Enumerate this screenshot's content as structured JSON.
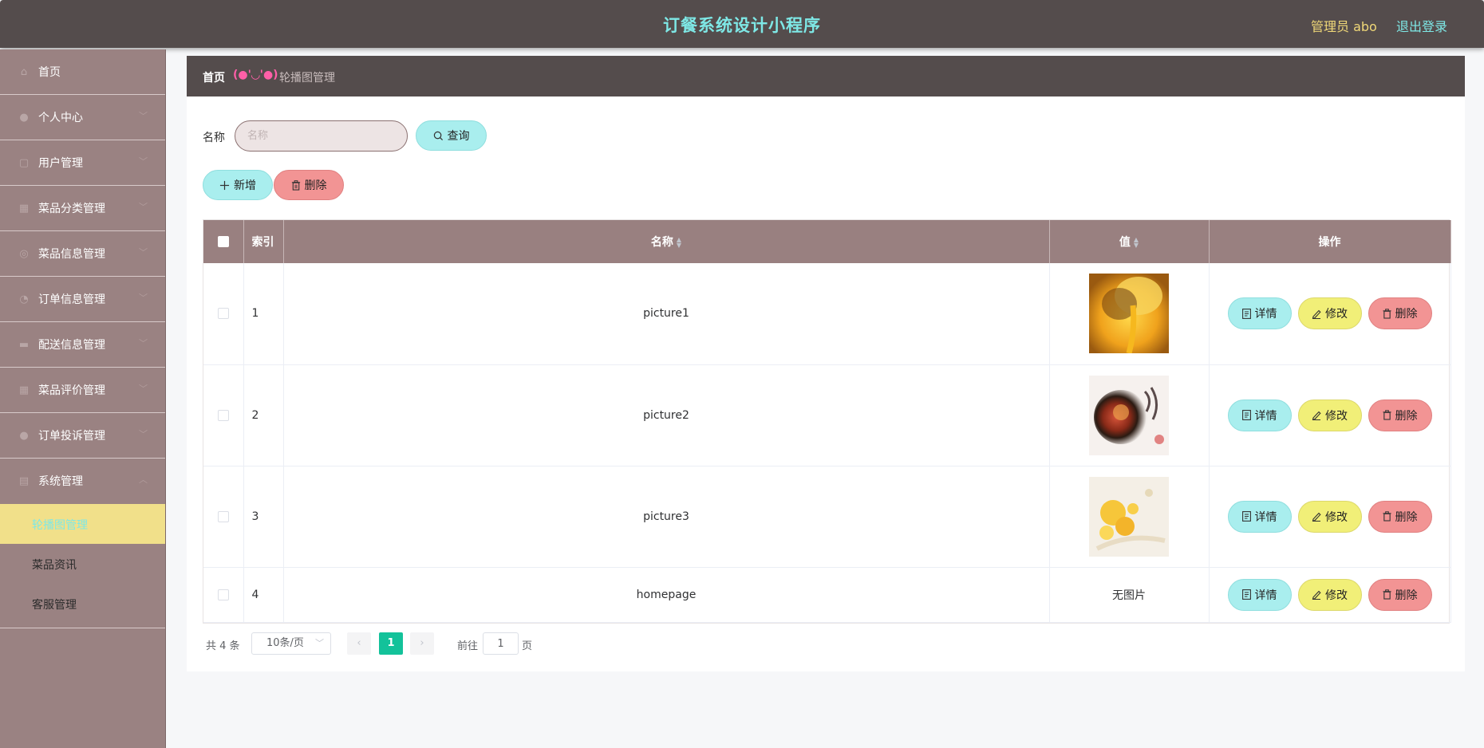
{
  "header": {
    "title": "订餐系统设计小程序",
    "admin": "管理员 abo",
    "logout": "退出登录"
  },
  "sidebar": {
    "items": [
      {
        "label": "首页",
        "icon": "home-icon",
        "arrow": false
      },
      {
        "label": "个人中心",
        "icon": "user-icon",
        "arrow": true
      },
      {
        "label": "用户管理",
        "icon": "users-icon",
        "arrow": true
      },
      {
        "label": "菜品分类管理",
        "icon": "category-icon",
        "arrow": true
      },
      {
        "label": "菜品信息管理",
        "icon": "dish-icon",
        "arrow": true
      },
      {
        "label": "订单信息管理",
        "icon": "order-icon",
        "arrow": true
      },
      {
        "label": "配送信息管理",
        "icon": "delivery-icon",
        "arrow": true
      },
      {
        "label": "菜品评价管理",
        "icon": "review-icon",
        "arrow": true
      },
      {
        "label": "订单投诉管理",
        "icon": "complaint-icon",
        "arrow": true
      },
      {
        "label": "系统管理",
        "icon": "settings-icon",
        "arrow": true
      }
    ],
    "subitems": [
      "轮播图管理",
      "菜品资讯",
      "客服管理"
    ]
  },
  "breadcrumb": {
    "home": "首页",
    "face": "(●'◡'●)",
    "current": "轮播图管理"
  },
  "search": {
    "label": "名称",
    "placeholder": "名称",
    "query_label": "查询"
  },
  "actions": {
    "add_label": "新增",
    "delete_label": "删除"
  },
  "table": {
    "headers": {
      "index": "索引",
      "name": "名称",
      "value": "值",
      "ops": "操作"
    },
    "rows": [
      {
        "index": "1",
        "name": "picture1",
        "image": "thumb-honey"
      },
      {
        "index": "2",
        "name": "picture2",
        "image": "thumb-bowl"
      },
      {
        "index": "3",
        "name": "picture3",
        "image": "thumb-corn"
      },
      {
        "index": "4",
        "name": "homepage",
        "image": "",
        "no_image": "无图片"
      }
    ],
    "op_labels": {
      "detail": "详情",
      "edit": "修改",
      "delete": "删除"
    }
  },
  "pagination": {
    "total": "共 4 条",
    "page_size": "10条/页",
    "current_page": "1",
    "goto_label": "前往",
    "goto_value": "1",
    "page_suffix": "页"
  }
}
